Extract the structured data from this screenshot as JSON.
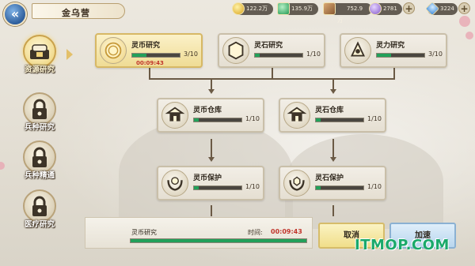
{
  "header": {
    "title": "金乌营",
    "back_icon": "back-arrow-icon"
  },
  "resources": [
    {
      "name": "gold",
      "value": "122.2万",
      "color": "#f0c43a"
    },
    {
      "name": "gem",
      "value": "135.9万",
      "color": "#3bb36b"
    },
    {
      "name": "wood",
      "value": "752.9万",
      "color": "#a8754a"
    },
    {
      "name": "crystal",
      "value": "2781",
      "color": "#9a72d6"
    },
    {
      "name": "diamond",
      "value": "3224",
      "color": "#5aa6e8"
    }
  ],
  "sidebar": {
    "items": [
      {
        "label": "资源研究",
        "active": true,
        "locked": false
      },
      {
        "label": "兵种研究",
        "active": false,
        "locked": true
      },
      {
        "label": "兵种精通",
        "active": false,
        "locked": true
      },
      {
        "label": "医疗研究",
        "active": false,
        "locked": true
      }
    ]
  },
  "research": [
    {
      "name": "灵币研究",
      "count": "3/10",
      "progress": 0.3,
      "timer": "00:09:43",
      "active": true
    },
    {
      "name": "灵石研究",
      "count": "1/10",
      "progress": 0.1,
      "active": false
    },
    {
      "name": "灵力研究",
      "count": "3/10",
      "progress": 0.3,
      "active": false
    },
    {
      "name": "灵币仓库",
      "count": "1/10",
      "progress": 0.1,
      "active": false
    },
    {
      "name": "灵石仓库",
      "count": "1/10",
      "progress": 0.1,
      "active": false
    },
    {
      "name": "灵币保护",
      "count": "1/10",
      "progress": 0.1,
      "active": false
    },
    {
      "name": "灵石保护",
      "count": "1/10",
      "progress": 0.1,
      "active": false
    }
  ],
  "bottom_panel": {
    "name": "灵币研究",
    "time_label": "时间:",
    "time": "00:09:43",
    "progress": 0.0
  },
  "buttons": {
    "cancel": "取消",
    "speed_up": "加速"
  },
  "watermark": "ITMOP.COM"
}
